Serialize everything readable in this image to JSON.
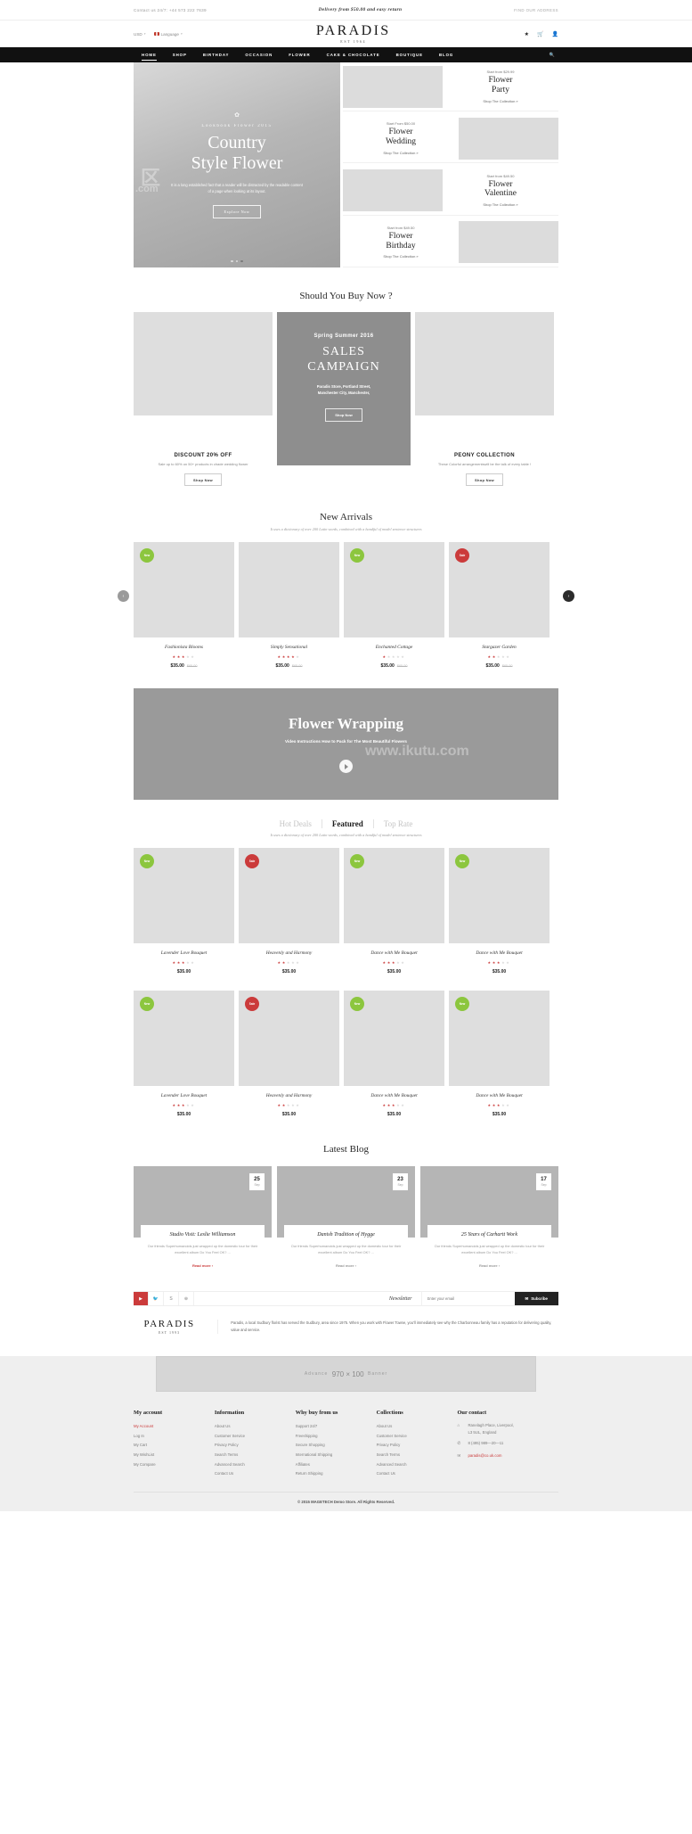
{
  "topbar": {
    "contact": "Contact us 24/7: +44 573 222 7639",
    "delivery": "Delivery from $50.00 and easy return",
    "address": "FIND OUR ADDRESS"
  },
  "header": {
    "currency": "USD",
    "language": "Language",
    "logo_main": "PARADIS",
    "logo_sub": "EST 1964",
    "icons": [
      "star-icon",
      "cart-icon",
      "user-icon"
    ]
  },
  "nav": {
    "items": [
      {
        "label": "HOME",
        "active": true
      },
      {
        "label": "SHOP",
        "active": false
      },
      {
        "label": "BIRTHDAY",
        "active": false
      },
      {
        "label": "OCCASION",
        "active": false
      },
      {
        "label": "FLOWER",
        "active": false
      },
      {
        "label": "CAKE & CHOCOLATE",
        "active": false
      },
      {
        "label": "BOUTIQUE",
        "active": false
      },
      {
        "label": "BLOG",
        "active": false
      }
    ],
    "search_icon": "search-icon"
  },
  "hero": {
    "kicker": "Lookbook Flower 2015",
    "title_line1": "Country",
    "title_line2": "Style Flower",
    "desc": "It is a long established fact that a reader will be distracted by the readable content of a page when looking at its layout.",
    "button": "Explore Now",
    "dots": 3,
    "active_dot": 3
  },
  "promos": [
    {
      "from": "Start from $29.99",
      "name_line1": "Flower",
      "name_line2": "Party",
      "link": "Shop The Collection  »",
      "image_first": true
    },
    {
      "from": "Start From $50.00",
      "name_line1": "Flower",
      "name_line2": "Wedding",
      "link": "Shop The Collection  »",
      "image_first": false
    },
    {
      "from": "Start from $49.50",
      "name_line1": "Flower",
      "name_line2": "Valentine",
      "link": "Shop The Collection  »",
      "image_first": true
    },
    {
      "from": "Start from $49.50",
      "name_line1": "Flower",
      "name_line2": "Birthday",
      "link": "Shop The Collection  »",
      "image_first": false
    }
  ],
  "buy_now": {
    "title": "Should You Buy Now ?",
    "left": {
      "heading": "DISCOUNT 20% OFF",
      "text": "Sale up to 60% on 50+ products in chade wedding flower",
      "button": "Shop Now"
    },
    "middle": {
      "season": "Spring Summer 2016",
      "title_line1": "SALES",
      "title_line2": "CAMPAIGN",
      "address_line1": "Paradis Store, Portland Street,",
      "address_line2": "Manchester City, Manchester,",
      "button": "Shop Now"
    },
    "right": {
      "heading": "PEONY COLLECTION",
      "text": "These Colorful arrangementswill be the talk of every table !",
      "button": "Shop Now"
    }
  },
  "new_arrivals": {
    "title": "New Arrivals",
    "subtitle": "It uses a dictionary of over 200 Latin words, combined with a handful of model sentence structures",
    "products": [
      {
        "name": "Fashionista Blooms",
        "badge": "New",
        "badge_type": "new",
        "rating": 3,
        "price": "$35.00",
        "old_price": "$65.00"
      },
      {
        "name": "Simply Sensational",
        "badge": null,
        "badge_type": null,
        "rating": 4,
        "price": "$35.00",
        "old_price": "$65.00"
      },
      {
        "name": "Enchanted Cottage",
        "badge": "New",
        "badge_type": "new",
        "rating": 1,
        "price": "$35.00",
        "old_price": "$65.00"
      },
      {
        "name": "Stargazer Garden",
        "badge": "Sale",
        "badge_type": "sale",
        "rating": 2,
        "price": "$35.00",
        "old_price": "$65.00"
      }
    ]
  },
  "video": {
    "title": "Flower Wrapping",
    "subtitle": "Video Instructions How to Pack for The Most Beautiful Flowers",
    "play_icon": "play-icon"
  },
  "featured": {
    "tabs": [
      {
        "label": "Hot Deals",
        "active": false
      },
      {
        "label": "Featured",
        "active": true
      },
      {
        "label": "Top Rate",
        "active": false
      }
    ],
    "subtitle": "It uses a dictionary of over 200 Latin words, combined with a handful of model sentence structures",
    "row1": [
      {
        "name": "Lavender Love Bouquet",
        "badge": "New",
        "badge_type": "new",
        "rating": 3,
        "price": "$35.00"
      },
      {
        "name": "Heavenly and Harmony",
        "badge": "Sale",
        "badge_type": "sale",
        "rating": 2,
        "price": "$35.00"
      },
      {
        "name": "Dance with Me Bouquet",
        "badge": "New",
        "badge_type": "new",
        "rating": 3,
        "price": "$35.00"
      },
      {
        "name": "Dance with Me Bouquet",
        "badge": "New",
        "badge_type": "new",
        "rating": 3,
        "price": "$35.00"
      }
    ],
    "row2": [
      {
        "name": "Lavender Love Bouquet",
        "badge": "New",
        "badge_type": "new",
        "rating": 3,
        "price": "$35.00"
      },
      {
        "name": "Heavenly and Harmony",
        "badge": "Sale",
        "badge_type": "sale",
        "rating": 2,
        "price": "$35.00"
      },
      {
        "name": "Dance with Me Bouquet",
        "badge": "New",
        "badge_type": "new",
        "rating": 3,
        "price": "$35.00"
      },
      {
        "name": "Dance with Me Bouquet",
        "badge": "New",
        "badge_type": "new",
        "rating": 3,
        "price": "$35.00"
      }
    ]
  },
  "blog": {
    "title": "Latest Blog",
    "posts": [
      {
        "day": "25",
        "month": "Sep",
        "title": "Studio Visit: Leslie Williamson",
        "excerpt": "Our friends Superhumanoids just wrapped up the domestic tour for their excellent album Do You Feel OK? ...",
        "more": "Read more  ›",
        "hot": true
      },
      {
        "day": "23",
        "month": "Sep",
        "title": "Danish Tradition of Hygge",
        "excerpt": "Our friends Superhumanoids just wrapped up the domestic tour for their excellent album Do You Feel OK? ...",
        "more": "Read more  ›",
        "hot": false
      },
      {
        "day": "17",
        "month": "Sep",
        "title": "25 Years of Carhartt Work",
        "excerpt": "Our friends Superhumanoids just wrapped up the domestic tour for their excellent album Do You Feel OK? ...",
        "more": "Read more  ›",
        "hot": false
      }
    ]
  },
  "newsletter": {
    "socials": [
      "youtube-icon",
      "twitter-icon",
      "skype-icon",
      "google-plus-icon"
    ],
    "label": "Newsletter",
    "placeholder": "Enter your email",
    "button": "Subcribe",
    "button_icon": "envelope-icon"
  },
  "footer": {
    "logo_main": "PARADIS",
    "logo_sub": "EST 1993",
    "about": "Paradis, a local Sudbury florist has served the Sudbury, area since 1975. When you work with Flower Towne, you'll immediately see why the Charbonneau family has a reputation for delivering quality, value and service.",
    "banner": {
      "prefix": "Advance",
      "size": "970 × 100",
      "suffix": "Banner"
    },
    "columns": [
      {
        "title": "My account",
        "links": [
          {
            "label": "My Account",
            "hot": true
          },
          {
            "label": "Log In",
            "hot": false
          },
          {
            "label": "My Cart",
            "hot": false
          },
          {
            "label": "My WishList",
            "hot": false
          },
          {
            "label": "My Compare",
            "hot": false
          }
        ]
      },
      {
        "title": "Information",
        "links": [
          {
            "label": "About Us",
            "hot": false
          },
          {
            "label": "Customer Service",
            "hot": false
          },
          {
            "label": "Privacy Policy",
            "hot": false
          },
          {
            "label": "Search Terms",
            "hot": false
          },
          {
            "label": "Advanced Search",
            "hot": false
          },
          {
            "label": "Contact Us",
            "hot": false
          }
        ]
      },
      {
        "title": "Why buy from us",
        "links": [
          {
            "label": "Support 24/7",
            "hot": false
          },
          {
            "label": "Freeshipping",
            "hot": false
          },
          {
            "label": "Secure Shopping",
            "hot": false
          },
          {
            "label": "International Shipping",
            "hot": false
          },
          {
            "label": "Affiliates",
            "hot": false
          },
          {
            "label": "Return Shipping",
            "hot": false
          }
        ]
      },
      {
        "title": "Collections",
        "links": [
          {
            "label": "About Us",
            "hot": false
          },
          {
            "label": "Customer Service",
            "hot": false
          },
          {
            "label": "Privacy Policy",
            "hot": false
          },
          {
            "label": "Search Terms",
            "hot": false
          },
          {
            "label": "Advanced Search",
            "hot": false
          },
          {
            "label": "Contact Us",
            "hot": false
          }
        ]
      }
    ],
    "contact": {
      "title": "Our contact",
      "address_line1": "Ranelagh Place, Liverpool,",
      "address_line2": "L3 5UL, England",
      "phone": "8 (495) 989—20—11",
      "email": "paradis@co.uk.com"
    },
    "copyright": "© 2015 MAGETECH Demo Store. All Rights Reserved."
  }
}
